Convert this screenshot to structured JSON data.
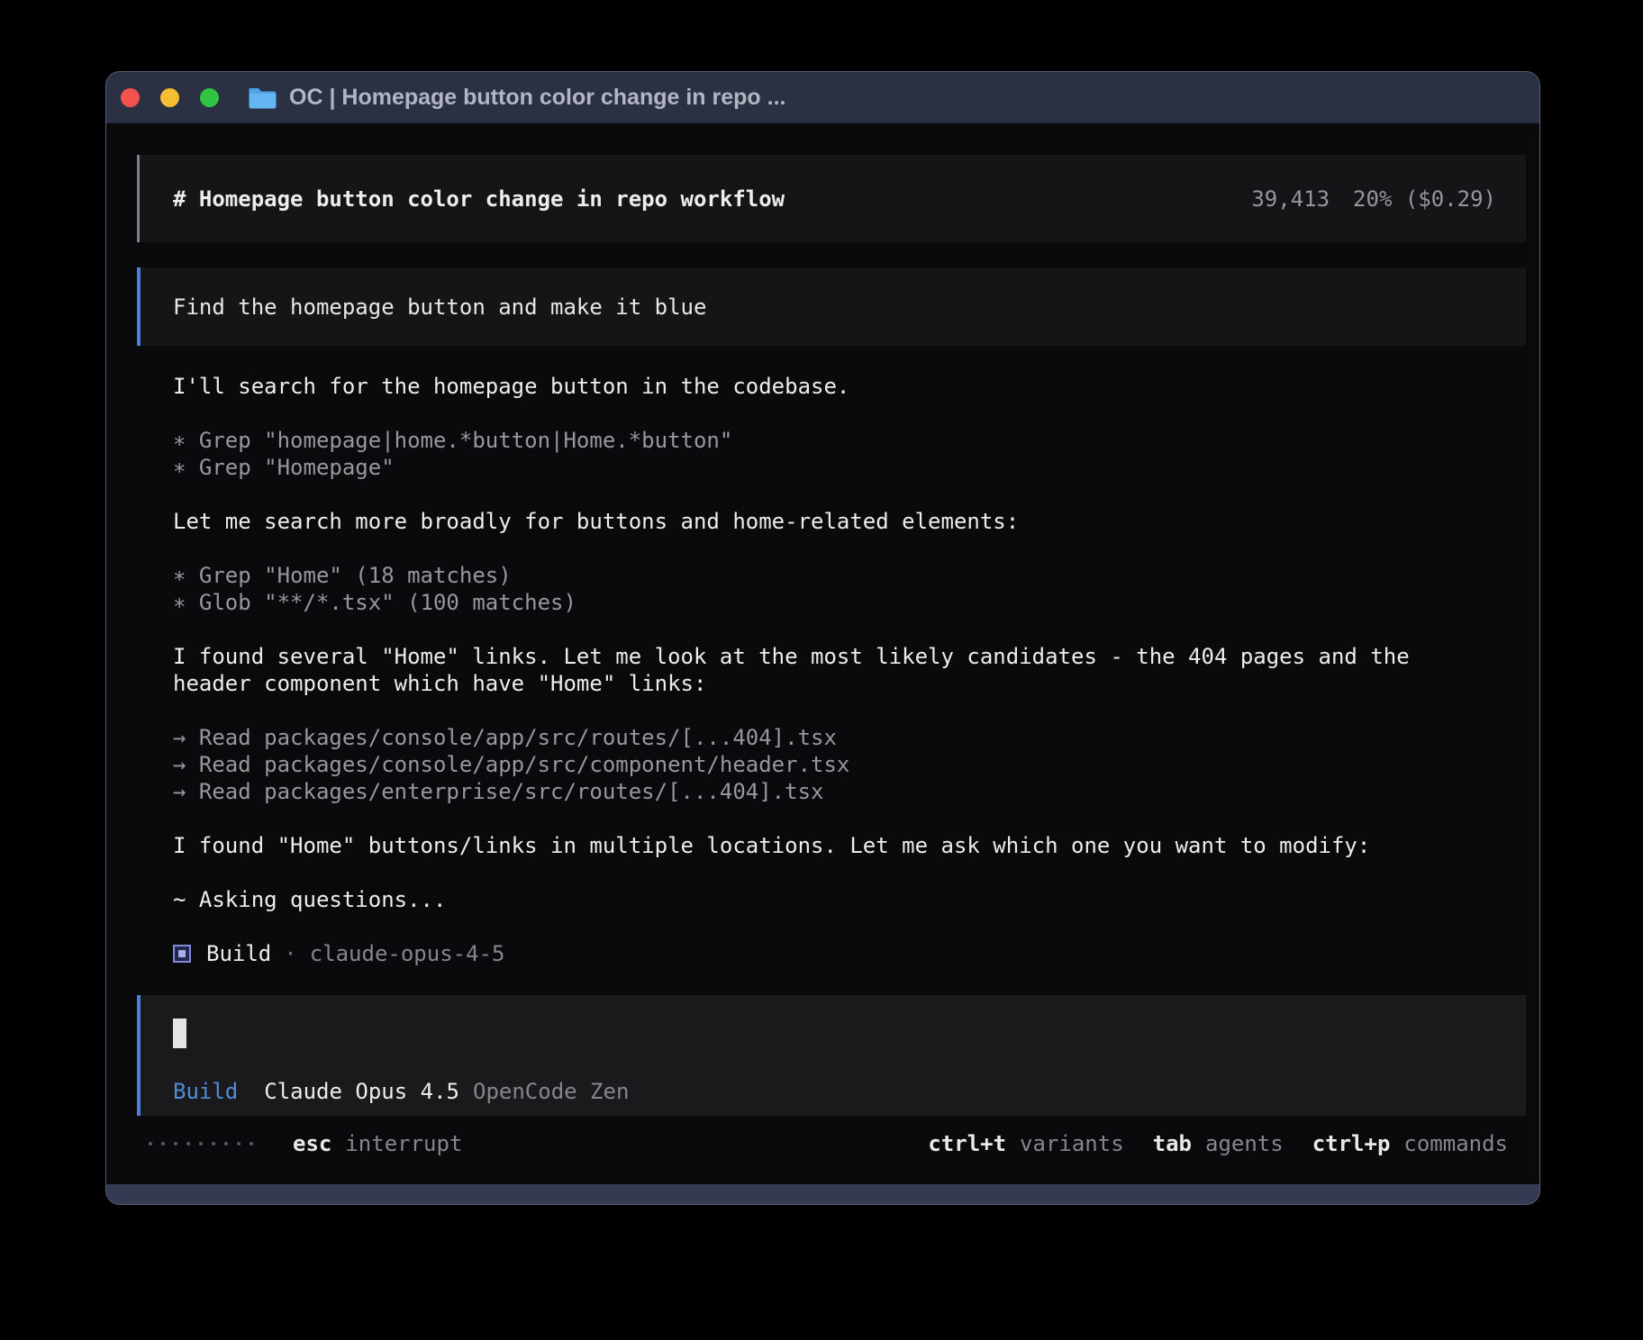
{
  "window": {
    "title": "OC | Homepage button color change in repo ...",
    "folder_icon": "blue-folder-icon"
  },
  "header": {
    "title": "# Homepage button color change in repo workflow",
    "tokens": "39,413",
    "context": "20% ($0.29)"
  },
  "user_message": {
    "text": "Find the homepage button and make it blue"
  },
  "chat": {
    "intro": "I'll search for the homepage button in the codebase.",
    "tools_search": [
      "∗ Grep \"homepage|home.*button|Home.*button\"",
      "∗ Grep \"Homepage\""
    ],
    "broadly": "Let me search more broadly for buttons and home-related elements:",
    "tools_broad": [
      "∗ Grep \"Home\" (18 matches)",
      "∗ Glob \"**/*.tsx\" (100 matches)"
    ],
    "found_links_lines": [
      "I found several \"Home\" links. Let me look at the most likely candidates - the 404 pages and the",
      "header component which have \"Home\" links:"
    ],
    "tools_read": [
      "→ Read packages/console/app/src/routes/[...404].tsx",
      "→ Read packages/console/app/src/component/header.tsx",
      "→ Read packages/enterprise/src/routes/[...404].tsx"
    ],
    "found_buttons": "I found \"Home\" buttons/links in multiple locations. Let me ask which one you want to modify:",
    "asking": "~ Asking questions...",
    "agent": {
      "icon": "build-agent-icon",
      "label": "Build",
      "separator": "·",
      "model": "claude-opus-4-5"
    }
  },
  "input": {
    "mode": "Build",
    "model": "Claude Opus 4.5",
    "provider": "OpenCode Zen"
  },
  "status": {
    "interrupt": {
      "key": "esc",
      "label": "interrupt"
    },
    "hints": [
      {
        "key": "ctrl+t",
        "label": "variants"
      },
      {
        "key": "tab",
        "label": "agents"
      },
      {
        "key": "ctrl+p",
        "label": "commands"
      }
    ]
  },
  "colors": {
    "accent_blue": "#4a80e0",
    "build_blue": "#538bdb",
    "agent_icon_blue": "#8089da",
    "traffic_red": "#f2544d",
    "traffic_yellow": "#f5bf33",
    "traffic_green": "#30c544"
  }
}
